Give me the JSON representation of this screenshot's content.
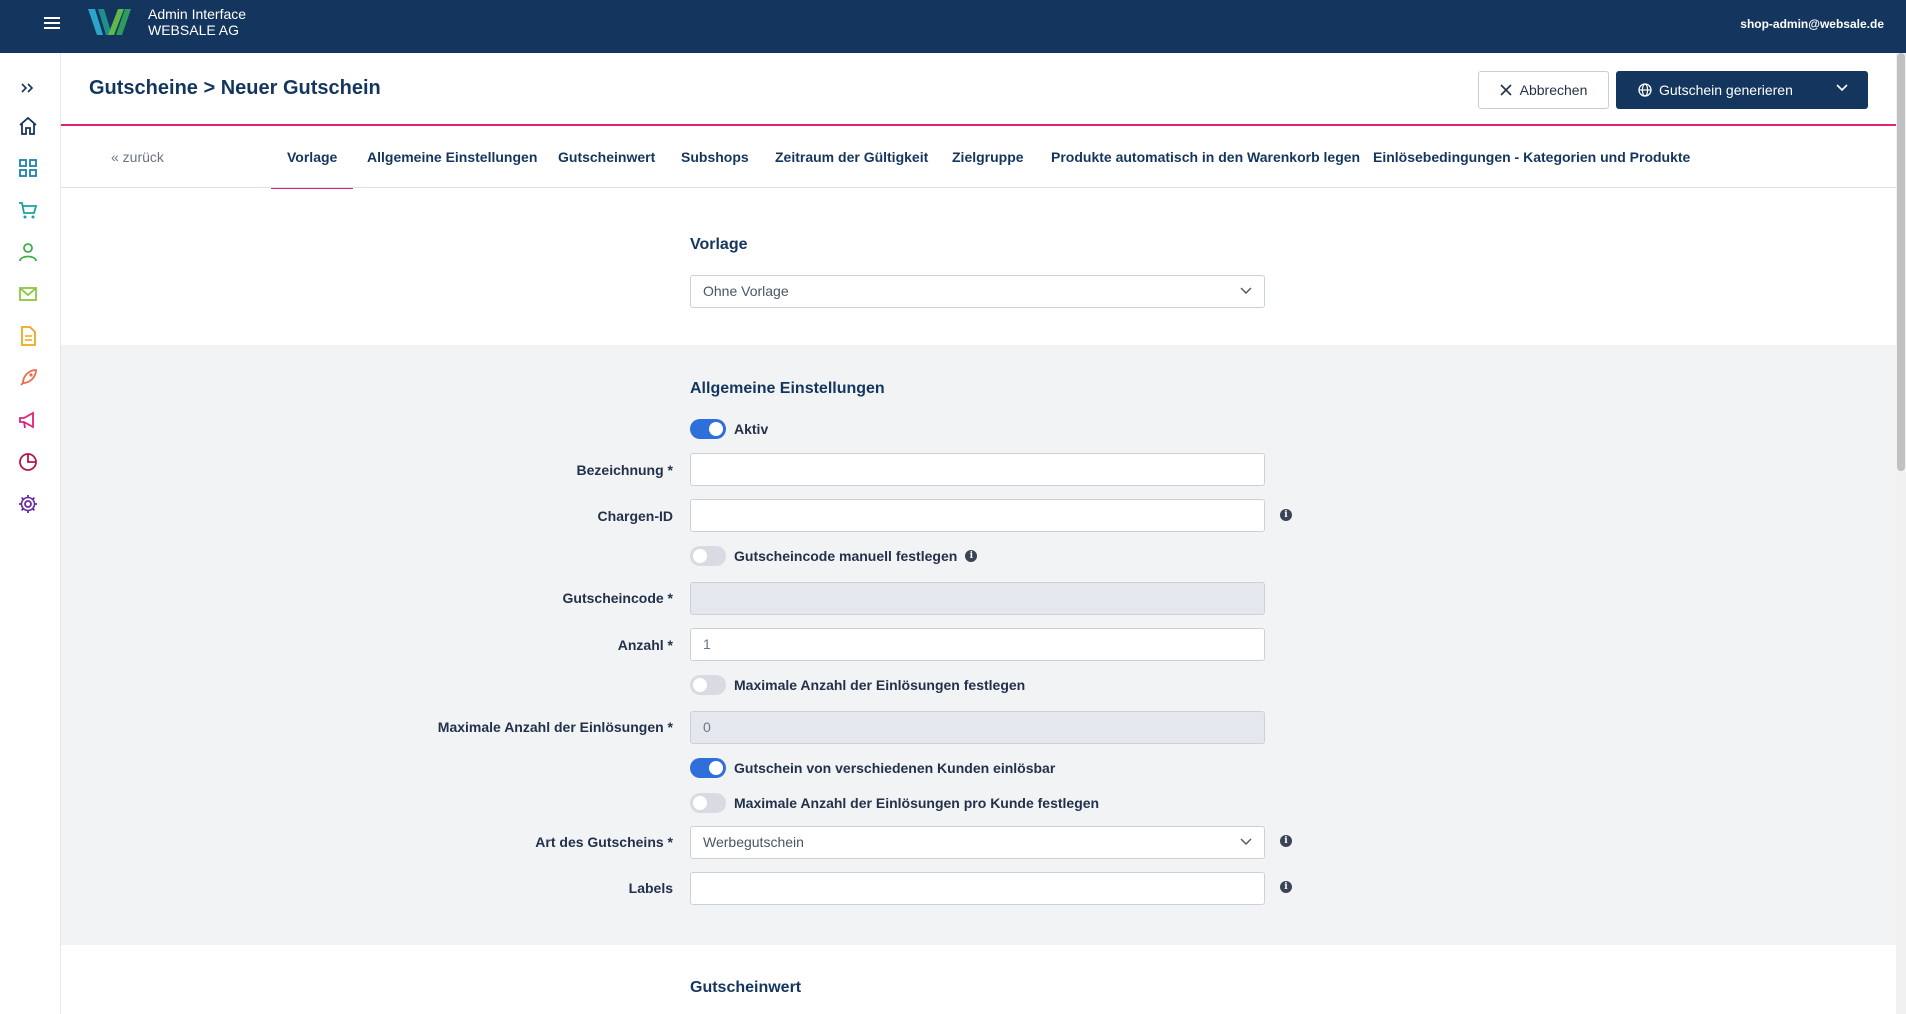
{
  "header": {
    "brand_line1": "Admin Interface",
    "brand_line2": "WEBSALE AG",
    "user_email": "shop-admin@websale.de",
    "brand_colors": {
      "topbar": "#14365e",
      "accent": "#e0217a",
      "toggle_on": "#2f6fdc"
    }
  },
  "sidebar": {
    "items": [
      {
        "icon": "expand-icon"
      },
      {
        "icon": "home-icon"
      },
      {
        "icon": "dashboard-grid-icon"
      },
      {
        "icon": "cart-icon"
      },
      {
        "icon": "user-icon"
      },
      {
        "icon": "mail-icon"
      },
      {
        "icon": "document-icon"
      },
      {
        "icon": "rocket-icon"
      },
      {
        "icon": "megaphone-icon"
      },
      {
        "icon": "pie-chart-icon"
      },
      {
        "icon": "gear-icon"
      }
    ]
  },
  "page": {
    "title": "Gutscheine > Neuer Gutschein",
    "cancel_label": "Abbrechen",
    "generate_label": "Gutschein generieren"
  },
  "tabs": {
    "back_label": "« zurück",
    "items": [
      {
        "label": "Vorlage",
        "active": true
      },
      {
        "label": "Allgemeine Einstellungen"
      },
      {
        "label": "Gutscheinwert"
      },
      {
        "label": "Subshops"
      },
      {
        "label": "Zeitraum der Gültigkeit"
      },
      {
        "label": "Zielgruppe"
      },
      {
        "label": "Produkte automatisch in den Warenkorb legen"
      },
      {
        "label": "Einlösebedingungen - Kategorien und Produkte"
      }
    ]
  },
  "vorlage": {
    "title": "Vorlage",
    "selected": "Ohne Vorlage"
  },
  "allgemein": {
    "title": "Allgemeine Einstellungen",
    "aktiv_label": "Aktiv",
    "aktiv_on": true,
    "bezeichnung_label": "Bezeichnung *",
    "bezeichnung_value": "",
    "chargen_label": "Chargen-ID",
    "chargen_value": "",
    "code_manual_label": "Gutscheincode manuell festlegen",
    "code_manual_on": false,
    "code_label": "Gutscheincode *",
    "code_value": "",
    "anzahl_label": "Anzahl *",
    "anzahl_value": "1",
    "max_toggle_label": "Maximale Anzahl der Einlösungen festlegen",
    "max_toggle_on": false,
    "max_label": "Maximale Anzahl der Einlösungen *",
    "max_value": "0",
    "multi_customer_label": "Gutschein von verschiedenen Kunden einlösbar",
    "multi_customer_on": true,
    "max_per_customer_label": "Maximale Anzahl der Einlösungen pro Kunde festlegen",
    "max_per_customer_on": false,
    "art_label": "Art des Gutscheins *",
    "art_selected": "Werbegutschein",
    "labels_label": "Labels",
    "labels_value": ""
  },
  "gutscheinwert": {
    "title": "Gutscheinwert"
  }
}
